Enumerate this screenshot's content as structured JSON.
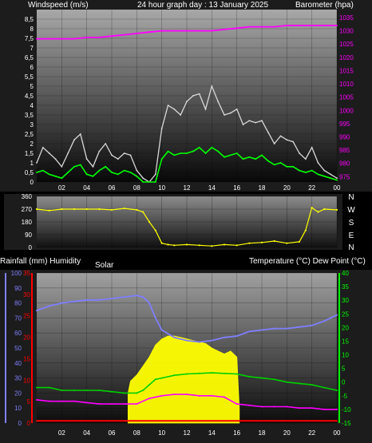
{
  "header": {
    "wind_label": "Windspeed (m/s)",
    "title": "24 hour graph day : 13 January 2025",
    "baro_label": "Barometer (hpa)"
  },
  "mid_labels": {
    "rain_humid": "Rainfall (mm)  Humidity",
    "solar": "Solar",
    "temp_dew": "Temperature (°C) Dew Point (°C)"
  },
  "colors": {
    "windspeed": "#d8d8d8",
    "windavg": "#00ff00",
    "barometer": "#ff00ff",
    "wind_axis_ticks": "#ffffff",
    "baro_axis_ticks": "#ff00ff",
    "direction": "#ffff00",
    "humidity": "#7f7fff",
    "temperature": "#00d000",
    "dewpoint": "#ff00ff",
    "rainfall": "#ff0000",
    "solar": "#ffff00",
    "rain_axis": "#ff0000",
    "humid_axis": "#7f7fff",
    "temp_axis": "#00ff00"
  },
  "chart_data": [
    {
      "type": "line",
      "title": "24 hour graph day : 13 January 2025",
      "x_tick_labels": [
        "02",
        "04",
        "06",
        "08",
        "10",
        "12",
        "14",
        "16",
        "18",
        "20",
        "22",
        "00"
      ],
      "x_range_hours": [
        0,
        24
      ],
      "left_axis": {
        "label": "Windspeed (m/s)",
        "ylim": [
          0,
          9
        ],
        "ticks": [
          "0",
          "0,5",
          "1",
          "1,5",
          "2",
          "2,5",
          "3",
          "3,5",
          "4",
          "4,5",
          "5",
          "5,5",
          "6",
          "6,5",
          "7",
          "7,5",
          "8",
          "8,5"
        ]
      },
      "right_axis": {
        "label": "Barometer (hpa)",
        "ylim": [
          973,
          1038
        ],
        "ticks": [
          "975",
          "980",
          "985",
          "990",
          "995",
          "1000",
          "1005",
          "1010",
          "1015",
          "1020",
          "1025",
          "1030",
          "1035"
        ]
      },
      "series": [
        {
          "axis": "right",
          "x": [
            0,
            1,
            2,
            3,
            4,
            5,
            6,
            7,
            8,
            9,
            10,
            11,
            12,
            13,
            14,
            15,
            16,
            17,
            18,
            19,
            20,
            21,
            22,
            23,
            24
          ],
          "values": [
            1027,
            1027,
            1027,
            1027,
            1027.5,
            1027.5,
            1028,
            1028.5,
            1029,
            1029.5,
            1030,
            1030,
            1030,
            1030,
            1030,
            1030.5,
            1031,
            1031.5,
            1031.5,
            1031.5,
            1032,
            1032,
            1032,
            1032,
            1032
          ]
        },
        {
          "axis": "left",
          "x": [
            0,
            0.5,
            1,
            1.5,
            2,
            2.5,
            3,
            3.5,
            4,
            4.5,
            5,
            5.5,
            6,
            6.5,
            7,
            7.5,
            8,
            8.5,
            9,
            9.5,
            10,
            10.5,
            11,
            11.5,
            12,
            12.5,
            13,
            13.5,
            14,
            14.5,
            15,
            15.5,
            16,
            16.5,
            17,
            17.5,
            18,
            18.5,
            19,
            19.5,
            20,
            20.5,
            21,
            21.5,
            22,
            22.5,
            23,
            23.5,
            24
          ],
          "values": [
            1,
            1.8,
            1.5,
            1.2,
            0.8,
            1.5,
            2.2,
            2.5,
            1.2,
            0.8,
            1.6,
            2,
            1.4,
            1.2,
            1.5,
            1.4,
            0.6,
            0.2,
            0,
            0.4,
            2.8,
            4,
            3.8,
            3.5,
            4.2,
            4.5,
            4.6,
            3.8,
            5,
            4.2,
            3.5,
            3.6,
            3.8,
            3,
            3.2,
            3.1,
            3.2,
            2.6,
            2,
            2.4,
            2.2,
            2.1,
            1.5,
            1.2,
            1.8,
            1,
            0.6,
            0.4,
            0.2
          ]
        },
        {
          "axis": "left",
          "x": [
            0,
            0.5,
            1,
            1.5,
            2,
            2.5,
            3,
            3.5,
            4,
            4.5,
            5,
            5.5,
            6,
            6.5,
            7,
            7.5,
            8,
            8.5,
            9,
            9.5,
            10,
            10.5,
            11,
            11.5,
            12,
            12.5,
            13,
            13.5,
            14,
            14.5,
            15,
            15.5,
            16,
            16.5,
            17,
            17.5,
            18,
            18.5,
            19,
            19.5,
            20,
            20.5,
            21,
            21.5,
            22,
            22.5,
            23,
            23.5,
            24
          ],
          "values": [
            0.5,
            0.6,
            0.4,
            0.3,
            0.2,
            0.5,
            0.8,
            0.9,
            0.4,
            0.3,
            0.6,
            0.8,
            0.5,
            0.4,
            0.6,
            0.5,
            0.3,
            0,
            0,
            0,
            1.2,
            1.6,
            1.4,
            1.5,
            1.5,
            1.6,
            1.8,
            1.5,
            1.8,
            1.6,
            1.3,
            1.4,
            1.5,
            1.2,
            1.3,
            1.2,
            1.4,
            1.1,
            0.9,
            1,
            0.8,
            0.8,
            0.6,
            0.5,
            0.6,
            0.4,
            0.3,
            0.2,
            0.1
          ]
        }
      ]
    },
    {
      "type": "scatter",
      "x_range_hours": [
        0,
        24
      ],
      "ylim": [
        0,
        360
      ],
      "y_ticks": [
        "0",
        "90",
        "180",
        "270",
        "360"
      ],
      "compass_labels": [
        "N",
        "W",
        "S",
        "E",
        "N"
      ],
      "series": [
        {
          "x": [
            0,
            1,
            2,
            3,
            4,
            5,
            6,
            7,
            8,
            8.5,
            9,
            9.5,
            10,
            10.5,
            11,
            12,
            13,
            14,
            15,
            16,
            17,
            18,
            19,
            20,
            21,
            21.5,
            22,
            22.5,
            23,
            24
          ],
          "values": [
            270,
            260,
            270,
            270,
            270,
            270,
            265,
            275,
            265,
            250,
            180,
            120,
            30,
            20,
            15,
            20,
            15,
            10,
            20,
            15,
            30,
            35,
            45,
            30,
            40,
            120,
            280,
            250,
            270,
            265
          ]
        }
      ]
    },
    {
      "type": "line",
      "x_tick_labels": [
        "02",
        "04",
        "06",
        "08",
        "10",
        "12",
        "14",
        "16",
        "18",
        "20",
        "22",
        "00"
      ],
      "x_range_hours": [
        0,
        24
      ],
      "rain_axis": {
        "label": "Rainfall (mm)",
        "ylim": [
          0,
          35
        ],
        "ticks": [
          "0",
          "5",
          "10",
          "15",
          "20",
          "25",
          "30",
          "35"
        ]
      },
      "humidity_axis": {
        "label": "Humidity",
        "ylim": [
          0,
          100
        ],
        "ticks": [
          "0",
          "10",
          "20",
          "30",
          "40",
          "50",
          "60",
          "70",
          "80",
          "90",
          "100"
        ]
      },
      "temp_axis": {
        "label": "Temperature (°C) Dew Point (°C)",
        "ylim": [
          -15,
          40
        ],
        "ticks": [
          "-15",
          "-10",
          "-5",
          "0",
          "5",
          "10",
          "15",
          "20",
          "25",
          "30",
          "35",
          "40"
        ]
      },
      "solar_label": "Solar",
      "series": [
        {
          "axis": "humidity",
          "x": [
            0,
            1,
            2,
            3,
            4,
            5,
            6,
            7,
            8,
            8.5,
            9,
            9.5,
            10,
            11,
            12,
            13,
            14,
            15,
            16,
            17,
            18,
            19,
            20,
            21,
            22,
            23,
            24
          ],
          "values": [
            75,
            78,
            80,
            81,
            82,
            82,
            83,
            84,
            85,
            84,
            80,
            70,
            62,
            57,
            55,
            54,
            55,
            57,
            58,
            61,
            62,
            63,
            63,
            64,
            65,
            68,
            72
          ]
        },
        {
          "axis": "temp",
          "x": [
            0,
            1,
            2,
            3,
            4,
            5,
            6,
            7,
            8,
            8.5,
            9,
            9.5,
            10,
            11,
            12,
            13,
            14,
            15,
            16,
            17,
            18,
            19,
            20,
            21,
            22,
            23,
            24
          ],
          "values": [
            -2,
            -2,
            -3,
            -3,
            -3,
            -3,
            -3.5,
            -4,
            -4,
            -3,
            -1,
            1,
            1.5,
            2.5,
            3,
            3.2,
            3.4,
            3.2,
            3,
            2,
            1.5,
            1,
            0,
            -0.5,
            -1,
            -2,
            -3
          ]
        },
        {
          "axis": "temp",
          "x": [
            0,
            1,
            2,
            3,
            4,
            5,
            6,
            7,
            8,
            9,
            10,
            11,
            12,
            13,
            14,
            15,
            16,
            17,
            18,
            19,
            20,
            21,
            22,
            23,
            24
          ],
          "values": [
            -6.5,
            -7,
            -7,
            -7,
            -7.5,
            -8,
            -8,
            -8,
            -8,
            -6,
            -5,
            -4.5,
            -4.5,
            -5,
            -5,
            -5.5,
            -8,
            -8.5,
            -9,
            -9,
            -9,
            -9.5,
            -9.5,
            -10,
            -10
          ]
        },
        {
          "axis": "rain",
          "x": [
            0,
            24
          ],
          "values": [
            0.5,
            0.5
          ]
        },
        {
          "axis": "solar",
          "x": [
            7.3,
            7.5,
            8,
            8.5,
            9,
            9.5,
            10,
            10.5,
            11,
            11.5,
            12,
            12.5,
            13,
            13.5,
            14,
            14.5,
            15,
            15.5,
            16,
            16.2
          ],
          "values": [
            20,
            28,
            32,
            38,
            44,
            52,
            56,
            58,
            58,
            57,
            56,
            55,
            54,
            53,
            50,
            48,
            46,
            48,
            44,
            10
          ]
        }
      ]
    }
  ]
}
